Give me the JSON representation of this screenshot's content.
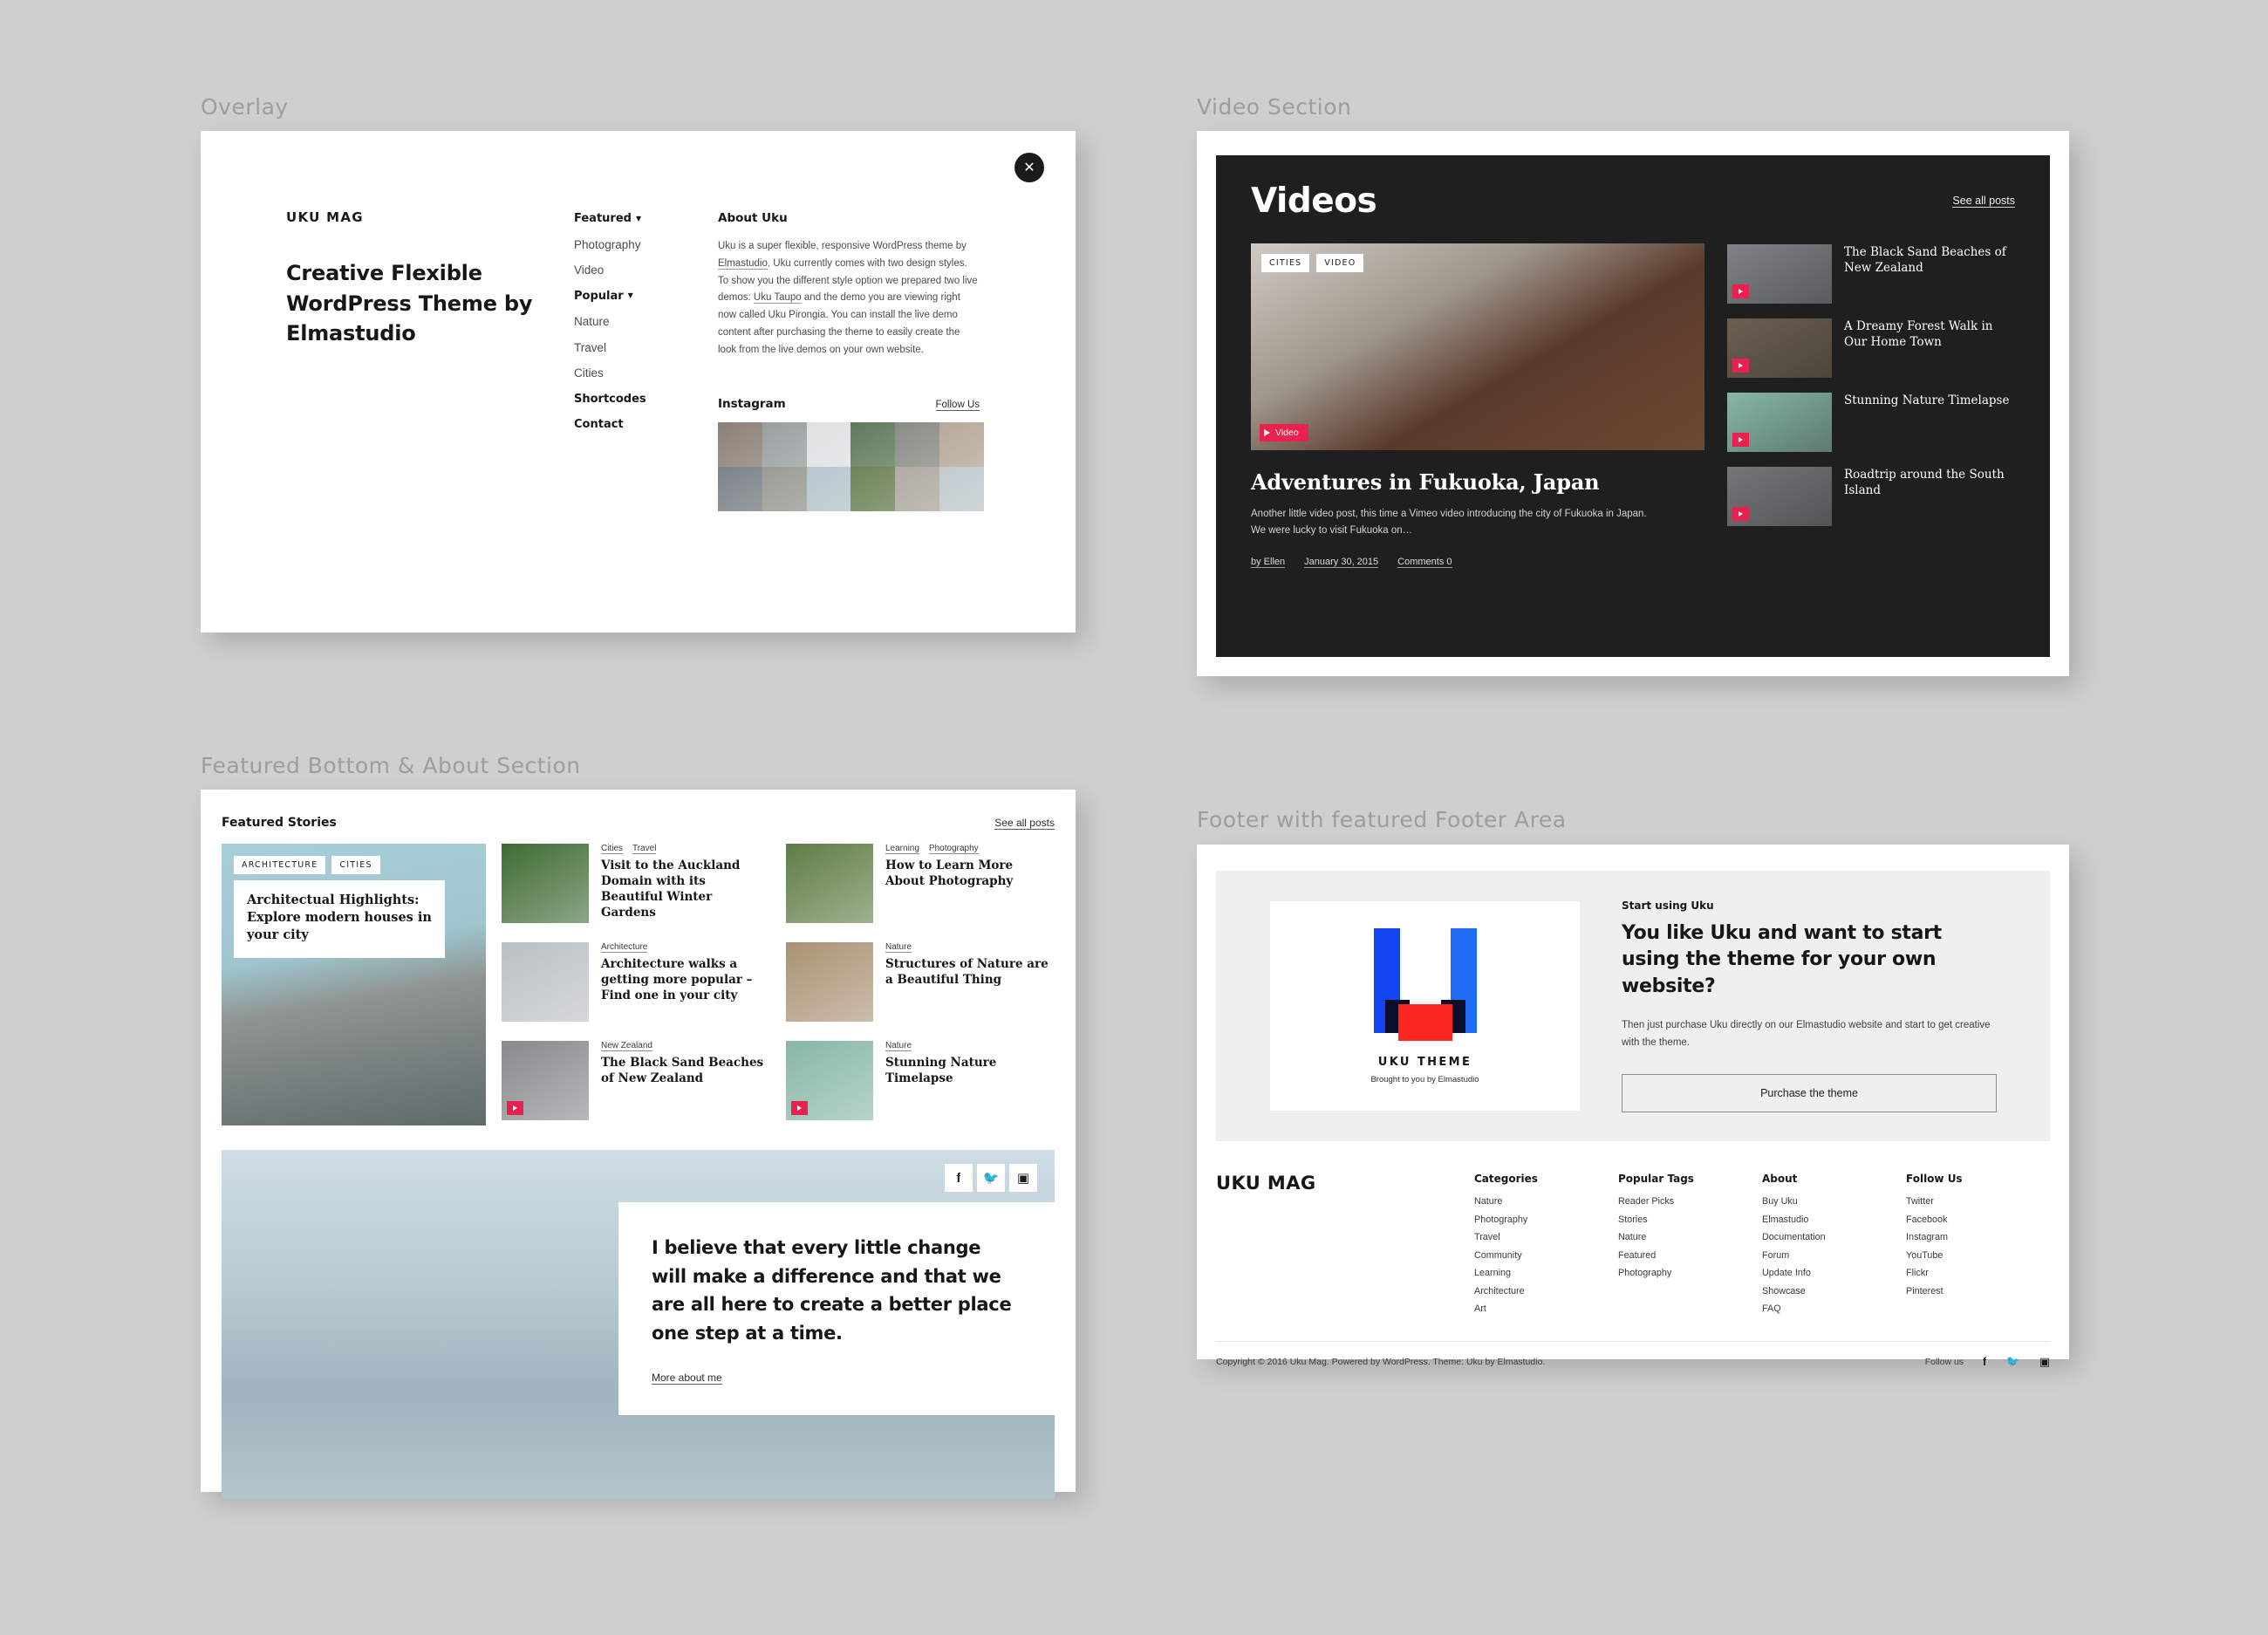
{
  "sections": {
    "overlay_label": "Overlay",
    "video_label": "Video Section",
    "featured_label": "Featured Bottom & About Section",
    "footer_label": "Footer with featured Footer Area"
  },
  "overlay": {
    "close_icon": "close-icon",
    "logo": "UKU MAG",
    "headline": "Creative Flexible WordPress Theme by Elmastudio",
    "menu": [
      {
        "label": "Featured",
        "bold": true,
        "caret": true
      },
      {
        "label": "Photography",
        "bold": false,
        "caret": false
      },
      {
        "label": "Video",
        "bold": false,
        "caret": false
      },
      {
        "label": "Popular",
        "bold": true,
        "caret": true
      },
      {
        "label": "Nature",
        "bold": false,
        "caret": false
      },
      {
        "label": "Travel",
        "bold": false,
        "caret": false
      },
      {
        "label": "Cities",
        "bold": false,
        "caret": false
      },
      {
        "label": "Shortcodes",
        "bold": true,
        "caret": false
      },
      {
        "label": "Contact",
        "bold": true,
        "caret": false
      }
    ],
    "about_title": "About Uku",
    "about_text_html": "Uku is a super flexible, responsive WordPress theme by <u>Elmastudio</u>. Uku currently comes with two design styles. To show you the different style option we prepared two live demos: <u>Uku Taupo</u> and the demo you are viewing right now called Uku Pirongia. You can install the live demo content after purchasing the theme to easily create the look from the live demos on your own website.",
    "instagram_title": "Instagram",
    "instagram_follow": "Follow Us",
    "instagram_tiles": [
      "#8d8076",
      "#9aa0a0",
      "#dfe1e2",
      "#5f7a5a",
      "#8a8d86",
      "#b8a99a",
      "#7d8389",
      "#9b9c94",
      "#b9c6cd",
      "#6f8459",
      "#b0aca3",
      "#c2cbd0"
    ]
  },
  "video": {
    "title": "Videos",
    "see_all": "See all posts",
    "main": {
      "badges": [
        "CITIES",
        "VIDEO"
      ],
      "play_label": "Video",
      "title": "Adventures in Fukuoka, Japan",
      "excerpt": "Another little video post, this time a Vimeo video introducing the city of Fukuoka in Japan. We were lucky to visit Fukuoka on…",
      "author": "by Ellen",
      "date": "January 30, 2015",
      "comments": "Comments 0"
    },
    "items": [
      {
        "title": "The Black Sand Beaches of New Zealand",
        "tint": "#7f8387"
      },
      {
        "title": "A Dreamy Forest Walk in Our Home Town",
        "tint": "#6b5f51"
      },
      {
        "title": "Stunning Nature Timelapse",
        "tint": "#87b7a4"
      },
      {
        "title": "Roadtrip around the South Island",
        "tint": "#74777a"
      }
    ],
    "accent_color": "#e8214f",
    "bg_color": "#1f1f1f"
  },
  "featured": {
    "title": "Featured Stories",
    "see_all": "See all posts",
    "hero": {
      "badges": [
        "ARCHITECTURE",
        "CITIES"
      ],
      "title": "Architectual Highlights: Explore modern houses in your city",
      "tint": "#9ec4cd"
    },
    "items": [
      {
        "cats": [
          "Cities",
          "Travel"
        ],
        "title": "Visit to the Auckland Domain with its Beautiful Winter Gardens",
        "tint": "#3f6b34",
        "video": false
      },
      {
        "cats": [
          "Architecture"
        ],
        "title": "Architecture walks a getting more popular – Find one in your city",
        "tint": "#b9bfc4",
        "video": false
      },
      {
        "cats": [
          "New Zealand"
        ],
        "title": "The Black Sand Beaches of New Zealand",
        "tint": "#868a8d",
        "video": true
      },
      {
        "cats": [
          "Learning",
          "Photography"
        ],
        "title": "How to Learn More About Photography",
        "tint": "#5f7c45",
        "video": false
      },
      {
        "cats": [
          "Nature"
        ],
        "title": "Structures of Nature are a Beautiful Thing",
        "tint": "#a99273",
        "video": false
      },
      {
        "cats": [
          "Nature"
        ],
        "title": "Stunning Nature Timelapse",
        "tint": "#87b7a4",
        "video": true
      }
    ],
    "about": {
      "social": [
        "facebook-icon",
        "twitter-icon",
        "instagram-icon"
      ],
      "quote": "I believe that every little change will make a difference and that we are all here to create a better place one step at a time.",
      "link": "More about me"
    }
  },
  "footer": {
    "cta": {
      "logo_name": "UKU THEME",
      "logo_sub": "Brought to you by Elmastudio",
      "eyebrow": "Start using Uku",
      "headline": "You like Uku and want to start using the theme for your own website?",
      "text": "Then just purchase Uku directly on our Elmastudio website and start to get creative with the theme.",
      "button": "Purchase the theme"
    },
    "brand": "UKU MAG",
    "columns": [
      {
        "heading": "Categories",
        "links": [
          "Nature",
          "Photography",
          "Travel",
          "Community",
          "Learning",
          "Architecture",
          "Art"
        ]
      },
      {
        "heading": "Popular Tags",
        "links": [
          "Reader Picks",
          "Stories",
          "Nature",
          "Featured",
          "Photography"
        ]
      },
      {
        "heading": "About",
        "links": [
          "Buy Uku",
          "Elmastudio",
          "Documentation",
          "Forum",
          "Update Info",
          "Showcase",
          "FAQ"
        ]
      },
      {
        "heading": "Follow Us",
        "links": [
          "Twitter",
          "Facebook",
          "Instagram",
          "YouTube",
          "Flickr",
          "Pinterest"
        ]
      }
    ],
    "copyright": "Copyright © 2016 Uku Mag. Powered by WordPress. Theme: Uku by Elmastudio.",
    "follow_label": "Follow us",
    "follow_icons": [
      "facebook-icon",
      "twitter-icon",
      "instagram-icon"
    ]
  }
}
